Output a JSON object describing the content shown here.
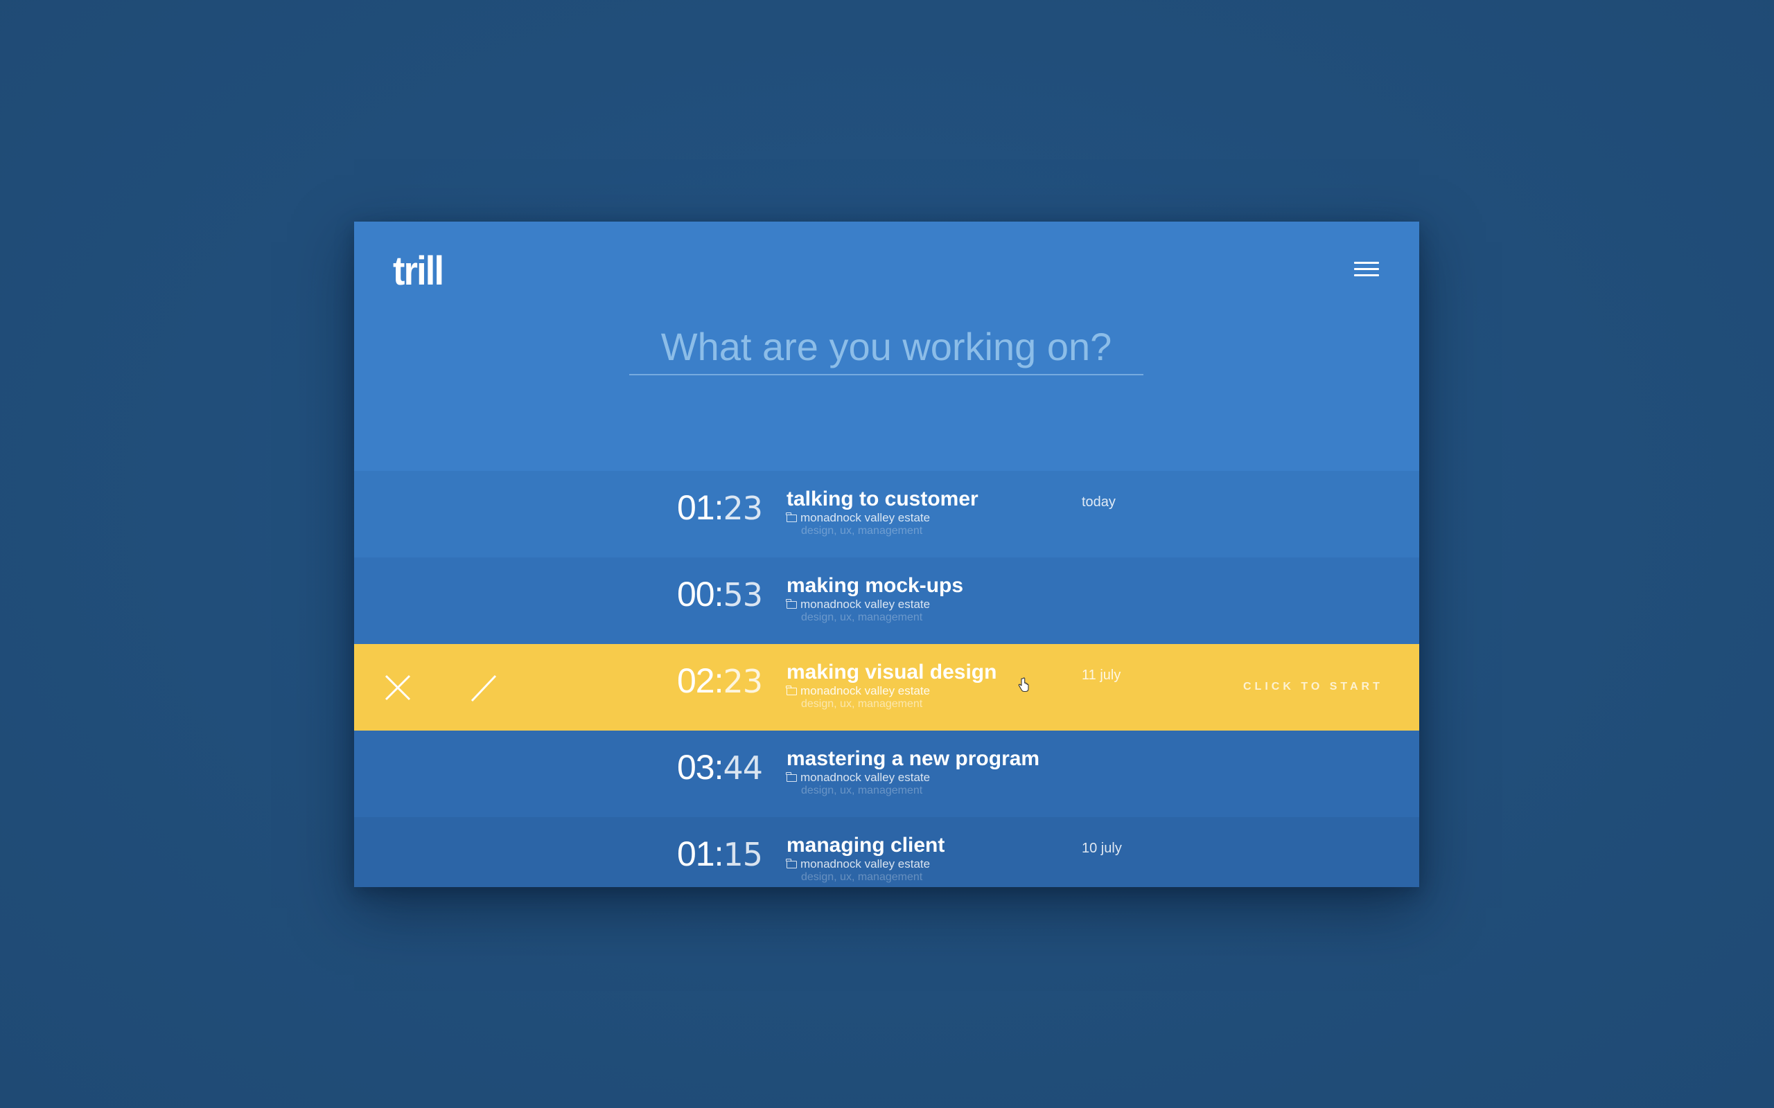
{
  "app": {
    "logo": "trill",
    "menu_icon": "hamburger-menu-icon"
  },
  "input": {
    "placeholder": "What are you working on?",
    "value": ""
  },
  "entries": [
    {
      "hours": "01",
      "minutes": "23",
      "title": "talking to customer",
      "project": "monadnock valley estate",
      "tags": "design, ux, management",
      "date": "today",
      "background": "#3678c0",
      "active": false
    },
    {
      "hours": "00",
      "minutes": "53",
      "title": "making mock-ups",
      "project": "monadnock valley estate",
      "tags": "design, ux, management",
      "date": "",
      "background": "#3271b8",
      "active": false
    },
    {
      "hours": "02",
      "minutes": "23",
      "title": "making visual design",
      "project": "monadnock valley estate",
      "tags": "design, ux, management",
      "date": "11 july",
      "background": "#f7cb4b",
      "active": true,
      "delete_icon": "close-icon",
      "edit_icon": "pencil-icon",
      "start_label": "CLICK TO START"
    },
    {
      "hours": "03",
      "minutes": "44",
      "title": "mastering a new program",
      "project": "monadnock valley estate",
      "tags": "design, ux, management",
      "date": "",
      "background": "#2f6bb0",
      "active": false
    },
    {
      "hours": "01",
      "minutes": "15",
      "title": "managing client",
      "project": "monadnock valley estate",
      "tags": "design, ux, management",
      "date": "10 july",
      "background": "#2c65a7",
      "active": false
    }
  ],
  "colors": {
    "page_background": "#214e7a",
    "header_background": "#3b7fc9",
    "accent_yellow": "#f7cb4b"
  }
}
